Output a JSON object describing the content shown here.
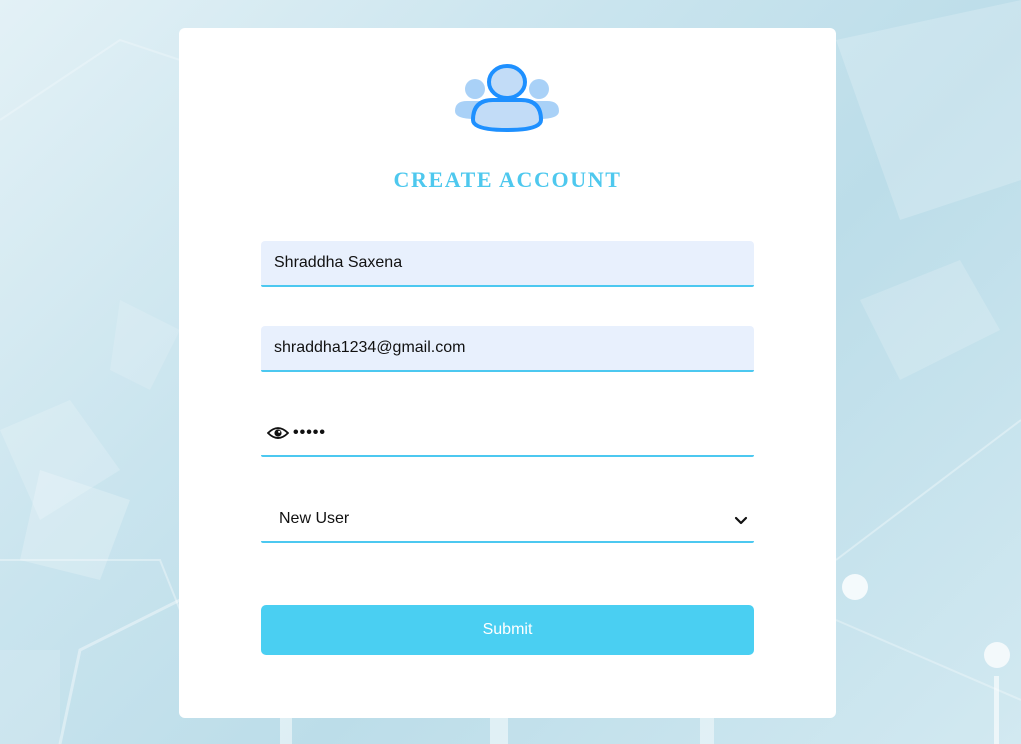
{
  "form": {
    "title": "CREATE ACCOUNT",
    "avatar_icon": "users-icon",
    "name_value": "Shraddha Saxena",
    "email_value": "shraddha1234@gmail.com",
    "password_masked": "•••••",
    "password_toggle_icon": "eye-icon",
    "role_selected": "New User",
    "role_dropdown_icon": "chevron-down-icon",
    "submit_label": "Submit"
  },
  "colors": {
    "accent": "#4ec8ee",
    "button": "#4acff2",
    "input_fill": "#e8f0fd",
    "icon_primary": "#1e90ff",
    "icon_secondary": "#a9d1f7"
  }
}
